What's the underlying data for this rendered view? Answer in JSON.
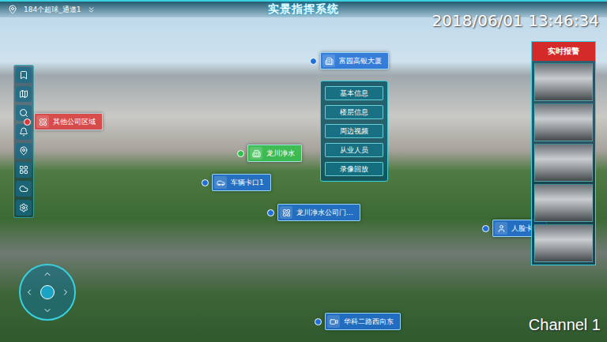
{
  "header": {
    "channel_select": "184个超球_通道1",
    "title": "实景指挥系统"
  },
  "video": {
    "timestamp": "2018/06/01 13:46:34",
    "channel": "Channel 1"
  },
  "sidebar": {
    "items": [
      {
        "kind": "bookmark",
        "selected": false
      },
      {
        "kind": "map",
        "selected": false
      },
      {
        "kind": "search",
        "selected": false
      },
      {
        "kind": "alarm",
        "selected": false
      },
      {
        "kind": "location",
        "selected": false
      },
      {
        "kind": "grid",
        "selected": false
      },
      {
        "kind": "cloud",
        "selected": false
      },
      {
        "kind": "settings",
        "selected": false
      }
    ]
  },
  "labels": [
    {
      "text": "富园高银大厦",
      "color": "#1f6fd6",
      "kind": "building"
    },
    {
      "text": "其他公司区域",
      "color": "#d93a3a",
      "kind": "area"
    },
    {
      "text": "龙川净水",
      "color": "#2fbf4a",
      "kind": "building"
    },
    {
      "text": "车辆卡口1",
      "color": "#1f6fd6",
      "kind": "car"
    },
    {
      "text": "龙川净水公司门…",
      "color": "#1f6fd6",
      "kind": "area"
    },
    {
      "text": "人脸卡口",
      "color": "#1f6fd6",
      "kind": "face"
    },
    {
      "text": "华科二路西向东",
      "color": "#1f6fd6",
      "kind": "camera"
    }
  ],
  "info_menu": {
    "items": [
      "基本信息",
      "楼层信息",
      "周边视频",
      "从业人员",
      "录像回放"
    ]
  },
  "alarm_panel": {
    "title": "实时报警",
    "snapshots": [
      {
        "selected": false
      },
      {
        "selected": false
      },
      {
        "selected": false
      },
      {
        "selected": false
      },
      {
        "selected": false
      }
    ]
  }
}
